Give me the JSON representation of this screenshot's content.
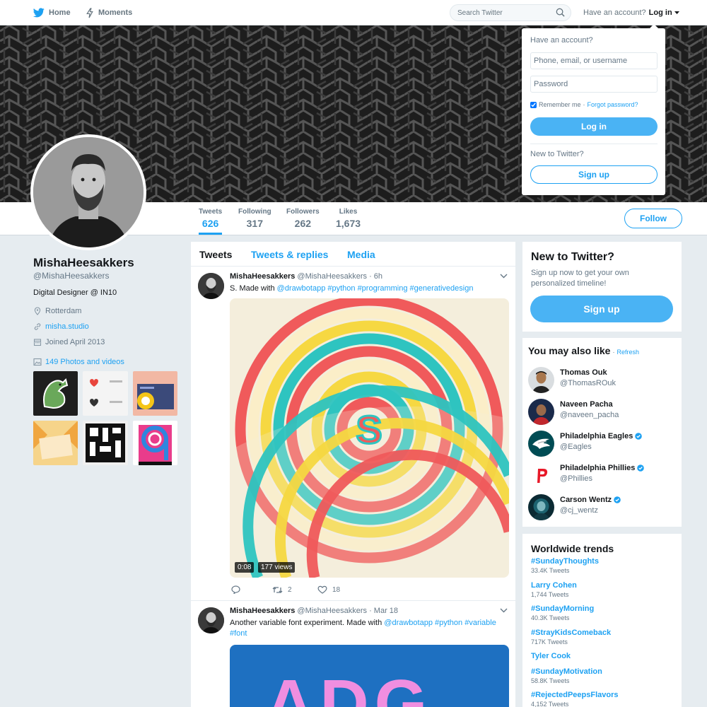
{
  "nav": {
    "home_label": "Home",
    "moments_label": "Moments",
    "search_placeholder": "Search Twitter",
    "have_account": "Have an account?",
    "login_label": "Log in"
  },
  "login_dropdown": {
    "heading": "Have an account?",
    "username_placeholder": "Phone, email, or username",
    "password_placeholder": "Password",
    "remember_label": "Remember me",
    "separator": "·",
    "forgot_label": "Forgot password?",
    "login_button": "Log in",
    "new_heading": "New to Twitter?",
    "signup_button": "Sign up"
  },
  "profile_nav": {
    "stats": [
      {
        "label": "Tweets",
        "value": "626"
      },
      {
        "label": "Following",
        "value": "317"
      },
      {
        "label": "Followers",
        "value": "262"
      },
      {
        "label": "Likes",
        "value": "1,673"
      }
    ],
    "follow_label": "Follow"
  },
  "profile": {
    "name": "MishaHeesakkers",
    "handle": "@MishaHeesakkers",
    "bio": "Digital Designer @ IN10",
    "location": "Rotterdam",
    "website": "misha.studio",
    "joined": "Joined April 2013",
    "photos_link": "149 Photos and videos"
  },
  "timeline": {
    "tabs": [
      "Tweets",
      "Tweets & replies",
      "Media"
    ],
    "tweets": [
      {
        "name": "MishaHeesakkers",
        "handle": "@MishaHeesakkers",
        "time": "· 6h",
        "text_plain": "S. Made with",
        "links": "@drawbotapp #python #programming #generativedesign",
        "video_time": "0:08",
        "video_views": "177 views",
        "retweets": "2",
        "likes": "18"
      },
      {
        "name": "MishaHeesakkers",
        "handle": "@MishaHeesakkers",
        "time": "· Mar 18",
        "text_plain": "Another variable font experiment. Made with",
        "links": "@drawbotapp #python #variable #font",
        "media_text": "ADG"
      }
    ]
  },
  "signup_card": {
    "title": "New to Twitter?",
    "text": "Sign up now to get your own personalized timeline!",
    "button": "Sign up"
  },
  "wtf": {
    "title": "You may also like",
    "separator": "·",
    "refresh": "Refresh",
    "items": [
      {
        "name": "Thomas Ouk",
        "handle": "@ThomasROuk",
        "verified": false
      },
      {
        "name": "Naveen Pacha",
        "handle": "@naveen_pacha",
        "verified": false
      },
      {
        "name": "Philadelphia Eagles",
        "handle": "@Eagles",
        "verified": true
      },
      {
        "name": "Philadelphia Phillies",
        "handle": "@Phillies",
        "verified": true
      },
      {
        "name": "Carson Wentz",
        "handle": "@cj_wentz",
        "verified": true
      }
    ]
  },
  "trends": {
    "title": "Worldwide trends",
    "items": [
      {
        "name": "#SundayThoughts",
        "count": "33.4K Tweets"
      },
      {
        "name": "Larry Cohen",
        "count": "1,744 Tweets"
      },
      {
        "name": "#SundayMorning",
        "count": "40.3K Tweets"
      },
      {
        "name": "#StrayKidsComeback",
        "count": "717K Tweets"
      },
      {
        "name": "Tyler Cook",
        "count": ""
      },
      {
        "name": "#SundayMotivation",
        "count": "58.8K Tweets"
      },
      {
        "name": "#RejectedPeepsFlavors",
        "count": "4,152 Tweets"
      }
    ]
  },
  "colors": {
    "accent": "#1da1f2",
    "button_blue": "#4ab3f4",
    "background": "#e6ecf0",
    "banner": "#1d1d1d"
  }
}
